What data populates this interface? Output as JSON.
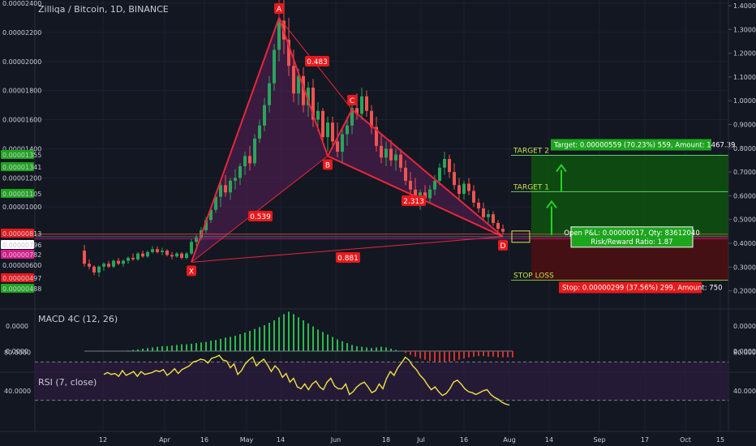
{
  "header": {
    "title": "Zilliqa / Bitcoin, 1D, BINANCE"
  },
  "colors": {
    "background": "#131722",
    "bull": "#26a65b",
    "bear": "#ef5350",
    "pattern": "#e8263a",
    "pattern_fill": "#5a1f57",
    "target_zone": "#0e4f10",
    "stop_zone": "#4a0f12",
    "rsi_line": "#f0e442",
    "rsi_band": "#2a1c3c",
    "label_red": "#e8191c",
    "label_green": "#1ea51e",
    "label_target": "#c8e04a"
  },
  "icons": [
    "up-arrow-icon",
    "up-arrow-icon"
  ],
  "chart_data": [
    {
      "type": "candlestick",
      "title": "Zilliqa / Bitcoin, 1D, BINANCE",
      "x": [
        "12",
        "Apr",
        "16",
        "May",
        "14",
        "Jun",
        "18",
        "Jul",
        "16",
        "Aug",
        "14",
        "Sep",
        "17",
        "Oct",
        "15"
      ],
      "y_left_ticks": [
        "0.00002400",
        "0.00002200",
        "0.00002000",
        "0.00001800",
        "0.00001600",
        "0.00001400",
        "0.00001200",
        "0.00001000"
      ],
      "y_left_badges": [
        {
          "label": "0.00001355",
          "color": "#1ea51e"
        },
        {
          "label": "0.00001341",
          "color": "#1ea51e"
        },
        {
          "label": "0.00001105",
          "color": "#1ea51e"
        },
        {
          "label": "0.00000813",
          "color": "#e8191c"
        },
        {
          "label": "0.00000796",
          "color": "#ffffff"
        },
        {
          "label": "0.00000782",
          "color": "#d81b8c"
        },
        {
          "label": "0.00000600",
          "color": ""
        },
        {
          "label": "0.00000497",
          "color": "#e8191c"
        },
        {
          "label": "0.00000488",
          "color": "#1ea51e"
        }
      ],
      "y_right_ticks": [
        "1.4000",
        "1.3000",
        "1.2000",
        "1.1000",
        "1.0000",
        "0.9000",
        "0.8000",
        "0.7000",
        "0.6000",
        "0.5000",
        "0.4000",
        "0.3000",
        "0.2000"
      ],
      "ohlc": [
        [
          7e-06,
          7.4e-06,
          5.9e-06,
          6.1e-06
        ],
        [
          6.1e-06,
          6.4e-06,
          5.7e-06,
          5.9e-06
        ],
        [
          5.9e-06,
          6e-06,
          5.3e-06,
          5.5e-06
        ],
        [
          5.5e-06,
          6e-06,
          5.2e-06,
          5.9e-06
        ],
        [
          5.9e-06,
          6.2e-06,
          5.6e-06,
          6.1e-06
        ],
        [
          6.1e-06,
          6.3e-06,
          5.8e-06,
          5.9e-06
        ],
        [
          5.9e-06,
          6.4e-06,
          5.8e-06,
          6.3e-06
        ],
        [
          6.3e-06,
          6.5e-06,
          6e-06,
          6.1e-06
        ],
        [
          6.1e-06,
          6.4e-06,
          5.9e-06,
          6.3e-06
        ],
        [
          6.3e-06,
          6.6e-06,
          6.1e-06,
          6.5e-06
        ],
        [
          6.5e-06,
          6.8e-06,
          6.3e-06,
          6.4e-06
        ],
        [
          6.4e-06,
          6.9e-06,
          6.3e-06,
          6.8e-06
        ],
        [
          6.8e-06,
          7e-06,
          6.5e-06,
          6.6e-06
        ],
        [
          6.6e-06,
          7e-06,
          6.5e-06,
          6.9e-06
        ],
        [
          6.9e-06,
          7.3e-06,
          6.8e-06,
          7.1e-06
        ],
        [
          7.1e-06,
          7.3e-06,
          6.8e-06,
          6.9e-06
        ],
        [
          6.9e-06,
          7.2e-06,
          6.7e-06,
          7e-06
        ],
        [
          7e-06,
          7.1e-06,
          6.6e-06,
          6.7e-06
        ],
        [
          6.7e-06,
          6.9e-06,
          6.4e-06,
          6.6e-06
        ],
        [
          6.6e-06,
          6.9e-06,
          6.5e-06,
          6.8e-06
        ],
        [
          6.8e-06,
          6.9e-06,
          6.4e-06,
          6.5e-06
        ],
        [
          6.5e-06,
          6.9e-06,
          6.4e-06,
          6.8e-06
        ],
        [
          6.8e-06,
          7.8e-06,
          6.7e-06,
          7.6e-06
        ],
        [
          7.6e-06,
          8.1e-06,
          7.3e-06,
          7.9e-06
        ],
        [
          7.9e-06,
          8.6e-06,
          7.7e-06,
          8.4e-06
        ],
        [
          8.4e-06,
          9.3e-06,
          8.2e-06,
          9.1e-06
        ],
        [
          9.1e-06,
          1e-05,
          8.9e-06,
          9.8e-06
        ],
        [
          9.8e-06,
          1.09e-05,
          9.6e-06,
          1.07e-05
        ],
        [
          1.07e-05,
          1.17e-05,
          1e-05,
          1.15e-05
        ],
        [
          1.15e-05,
          1.22e-05,
          1.07e-05,
          1.1e-05
        ],
        [
          1.1e-05,
          1.2e-05,
          1.05e-05,
          1.18e-05
        ],
        [
          1.18e-05,
          1.26e-05,
          1.12e-05,
          1.2e-05
        ],
        [
          1.2e-05,
          1.3e-05,
          1.15e-05,
          1.28e-05
        ],
        [
          1.28e-05,
          1.38e-05,
          1.22e-05,
          1.35e-05
        ],
        [
          1.35e-05,
          1.42e-05,
          1.25e-05,
          1.3e-05
        ],
        [
          1.3e-05,
          1.5e-05,
          1.28e-05,
          1.47e-05
        ],
        [
          1.47e-05,
          1.6e-05,
          1.44e-05,
          1.56e-05
        ],
        [
          1.56e-05,
          1.75e-05,
          1.52e-05,
          1.7e-05
        ],
        [
          1.7e-05,
          1.9e-05,
          1.65e-05,
          1.85e-05
        ],
        [
          1.85e-05,
          2.12e-05,
          1.8e-05,
          2.08e-05
        ],
        [
          2.08e-05,
          2.35e-05,
          2e-05,
          2.28e-05
        ],
        [
          2.28e-05,
          2.46e-05,
          2.05e-05,
          2.15e-05
        ],
        [
          2.15e-05,
          2.3e-05,
          1.9e-05,
          1.97e-05
        ],
        [
          1.97e-05,
          2.08e-05,
          1.72e-05,
          1.78e-05
        ],
        [
          1.78e-05,
          1.95e-05,
          1.7e-05,
          1.9e-05
        ],
        [
          1.9e-05,
          1.96e-05,
          1.65e-05,
          1.7e-05
        ],
        [
          1.7e-05,
          1.86e-05,
          1.62e-05,
          1.82e-05
        ],
        [
          1.82e-05,
          1.88e-05,
          1.55e-05,
          1.6e-05
        ],
        [
          1.6e-05,
          1.72e-05,
          1.52e-05,
          1.66e-05
        ],
        [
          1.66e-05,
          1.68e-05,
          1.44e-05,
          1.48e-05
        ],
        [
          1.48e-05,
          1.62e-05,
          1.38e-05,
          1.58e-05
        ],
        [
          1.58e-05,
          1.62e-05,
          1.4e-05,
          1.45e-05
        ],
        [
          1.45e-05,
          1.58e-05,
          1.34e-05,
          1.38e-05
        ],
        [
          1.38e-05,
          1.55e-05,
          1.3e-05,
          1.5e-05
        ],
        [
          1.5e-05,
          1.62e-05,
          1.42e-05,
          1.56e-05
        ],
        [
          1.56e-05,
          1.72e-05,
          1.5e-05,
          1.68e-05
        ],
        [
          1.68e-05,
          1.78e-05,
          1.6e-05,
          1.64e-05
        ],
        [
          1.64e-05,
          1.82e-05,
          1.6e-05,
          1.76e-05
        ],
        [
          1.76e-05,
          1.8e-05,
          1.62e-05,
          1.66e-05
        ],
        [
          1.66e-05,
          1.7e-05,
          1.5e-05,
          1.55e-05
        ],
        [
          1.55e-05,
          1.62e-05,
          1.38e-05,
          1.42e-05
        ],
        [
          1.42e-05,
          1.5e-05,
          1.3e-05,
          1.34e-05
        ],
        [
          1.34e-05,
          1.45e-05,
          1.28e-05,
          1.4e-05
        ],
        [
          1.4e-05,
          1.46e-05,
          1.28e-05,
          1.32e-05
        ],
        [
          1.32e-05,
          1.4e-05,
          1.25e-05,
          1.36e-05
        ],
        [
          1.36e-05,
          1.4e-05,
          1.24e-05,
          1.27e-05
        ],
        [
          1.27e-05,
          1.32e-05,
          1.15e-05,
          1.18e-05
        ],
        [
          1.18e-05,
          1.24e-05,
          1.08e-05,
          1.12e-05
        ],
        [
          1.12e-05,
          1.2e-05,
          1.02e-05,
          1.05e-05
        ],
        [
          1.05e-05,
          1.12e-05,
          9.8e-06,
          1.1e-05
        ],
        [
          1.1e-05,
          1.15e-05,
          1.03e-05,
          1.06e-05
        ],
        [
          1.06e-05,
          1.15e-05,
          1.02e-05,
          1.12e-05
        ],
        [
          1.12e-05,
          1.22e-05,
          1.08e-05,
          1.18e-05
        ],
        [
          1.18e-05,
          1.3e-05,
          1.15e-05,
          1.27e-05
        ],
        [
          1.27e-05,
          1.38e-05,
          1.22e-05,
          1.33e-05
        ],
        [
          1.33e-05,
          1.36e-05,
          1.2e-05,
          1.24e-05
        ],
        [
          1.24e-05,
          1.3e-05,
          1.12e-05,
          1.15e-05
        ],
        [
          1.15e-05,
          1.2e-05,
          1.05e-05,
          1.09e-05
        ],
        [
          1.09e-05,
          1.18e-05,
          1.05e-05,
          1.16e-05
        ],
        [
          1.16e-05,
          1.2e-05,
          1.08e-05,
          1.11e-05
        ],
        [
          1.11e-05,
          1.15e-05,
          1e-05,
          1.03e-05
        ],
        [
          1.03e-05,
          1.06e-05,
          9.6e-06,
          9.9e-06
        ],
        [
          9.9e-06,
          1.03e-05,
          9.1e-06,
          9.3e-06
        ],
        [
          9.3e-06,
          9.8e-06,
          8.8e-06,
          9.5e-06
        ],
        [
          9.5e-06,
          9.7e-06,
          8.7e-06,
          8.9e-06
        ],
        [
          8.9e-06,
          9.1e-06,
          8.3e-06,
          8.5e-06
        ],
        [
          8.5e-06,
          8.8e-06,
          8.1e-06,
          8.3e-06
        ]
      ]
    },
    {
      "type": "harmonic-pattern",
      "points": [
        {
          "label": "X",
          "price": 6.2e-06
        },
        {
          "label": "A",
          "price": 2.3e-05
        },
        {
          "label": "B",
          "price": 1.35e-05
        },
        {
          "label": "C",
          "price": 1.67e-05
        },
        {
          "label": "D",
          "price": 7.96e-06
        }
      ],
      "ratios": [
        {
          "label": "0.539",
          "between": "X-B"
        },
        {
          "label": "0.483",
          "between": "A-C"
        },
        {
          "label": "2.313",
          "between": "B-D"
        },
        {
          "label": "0.881",
          "between": "X-D"
        }
      ]
    },
    {
      "type": "position",
      "levels": [
        {
          "label": "TARGET 2",
          "price": 1.355e-05
        },
        {
          "label": "TARGET 1",
          "price": 1.105e-05
        },
        {
          "label": "STOP LOSS",
          "price": 4.97e-06
        }
      ],
      "entry": 7.96e-06,
      "target_label": "Target: 0.00000559 (70.23%) 559, Amount: 1467.39",
      "pnl_label": "Open P&L: 0.00000017, Qty: 83612040",
      "rr_label": "Risk/Reward Ratio: 1.87",
      "stop_label": "Stop: 0.00000299 (37.56%) 299, Amount: 750"
    },
    {
      "type": "bar",
      "title": "MACD 4C (12, 26)",
      "y_ticks": [
        "0.0000",
        "0.0000"
      ],
      "values": [
        0,
        0,
        0,
        0,
        0,
        0,
        0,
        0,
        0,
        0.002,
        0.004,
        0.006,
        0.008,
        0.01,
        0.012,
        0.014,
        0.016,
        0.016,
        0.018,
        0.02,
        0.022,
        0.022,
        0.024,
        0.026,
        0.028,
        0.03,
        0.034,
        0.036,
        0.04,
        0.044,
        0.046,
        0.05,
        0.055,
        0.06,
        0.066,
        0.072,
        0.078,
        0.084,
        0.092,
        0.1,
        0.11,
        0.12,
        0.128,
        0.12,
        0.11,
        0.1,
        0.09,
        0.08,
        0.07,
        0.062,
        0.054,
        0.046,
        0.038,
        0.032,
        0.026,
        0.02,
        0.016,
        0.014,
        0.012,
        0.01,
        0.012,
        0.014,
        0.012,
        0.008,
        0.004,
        0,
        -0.006,
        -0.012,
        -0.018,
        -0.024,
        -0.028,
        -0.032,
        -0.034,
        -0.036,
        -0.036,
        -0.034,
        -0.032,
        -0.028,
        -0.024,
        -0.02,
        -0.018,
        -0.016,
        -0.016,
        -0.018,
        -0.018,
        -0.02,
        -0.02,
        -0.02,
        -0.02
      ]
    },
    {
      "type": "line",
      "title": "RSI (7, close)",
      "y_ticks": [
        "80.0000",
        "40.0000"
      ],
      "band": [
        30,
        70
      ],
      "values": [
        57,
        59,
        57,
        58,
        55,
        61,
        56,
        58,
        60,
        55,
        60,
        57,
        58,
        59,
        61,
        60,
        62,
        56,
        59,
        63,
        58,
        62,
        64,
        66,
        70,
        71,
        73,
        72,
        69,
        74,
        75,
        77,
        72,
        71,
        64,
        68,
        57,
        61,
        68,
        72,
        75,
        66,
        70,
        73,
        67,
        60,
        66,
        62,
        54,
        58,
        49,
        53,
        44,
        42,
        47,
        41,
        47,
        50,
        44,
        41,
        49,
        53,
        45,
        42,
        42,
        47,
        36,
        39,
        44,
        47,
        49,
        44,
        38,
        40,
        47,
        42,
        53,
        60,
        56,
        64,
        69,
        75,
        72,
        66,
        62,
        56,
        52,
        46,
        41,
        44,
        39,
        35,
        37,
        42,
        49,
        51,
        47,
        42,
        39,
        38,
        36,
        38,
        40,
        41,
        36,
        33,
        31,
        28,
        26,
        25
      ]
    }
  ]
}
